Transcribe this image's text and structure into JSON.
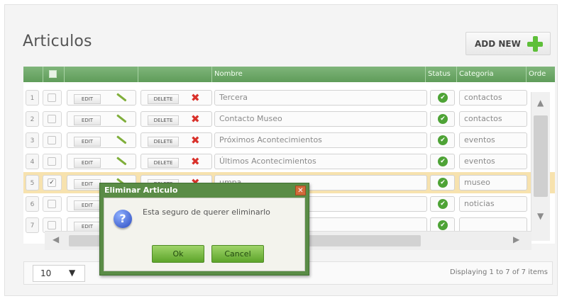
{
  "page": {
    "title": "Articulos",
    "add_label": "ADD NEW"
  },
  "grid": {
    "columns": [
      "Nombre",
      "Status",
      "Categoria",
      "Orde"
    ],
    "edit_label": "EDIT",
    "delete_label": "DELETE",
    "rows": [
      {
        "num": "1",
        "nombre": "Tercera",
        "categoria": "contactos",
        "selected": false
      },
      {
        "num": "2",
        "nombre": "Contacto Museo",
        "categoria": "contactos",
        "selected": false
      },
      {
        "num": "3",
        "nombre": "Próximos Acontecimientos",
        "categoria": "eventos",
        "selected": false
      },
      {
        "num": "4",
        "nombre": "Últimos Acontecimientos",
        "categoria": "eventos",
        "selected": false
      },
      {
        "num": "5",
        "nombre": "umpa",
        "categoria": "museo",
        "selected": true
      },
      {
        "num": "6",
        "nombre": "",
        "categoria": "noticias",
        "selected": false
      },
      {
        "num": "7",
        "nombre": "",
        "categoria": "",
        "selected": false
      }
    ]
  },
  "pager": {
    "page_size": "10",
    "info": "Displaying 1 to 7 of 7 items"
  },
  "dialog": {
    "title": "Eliminar Articulo",
    "message": "Esta seguro de querer eliminarlo",
    "ok_label": "Ok",
    "cancel_label": "Cancel"
  },
  "colors": {
    "header": "#6fa86a",
    "selected_row": "#f7e2ae",
    "dialog_border": "#5a8c46",
    "accent_plus": "#5ebf39"
  }
}
